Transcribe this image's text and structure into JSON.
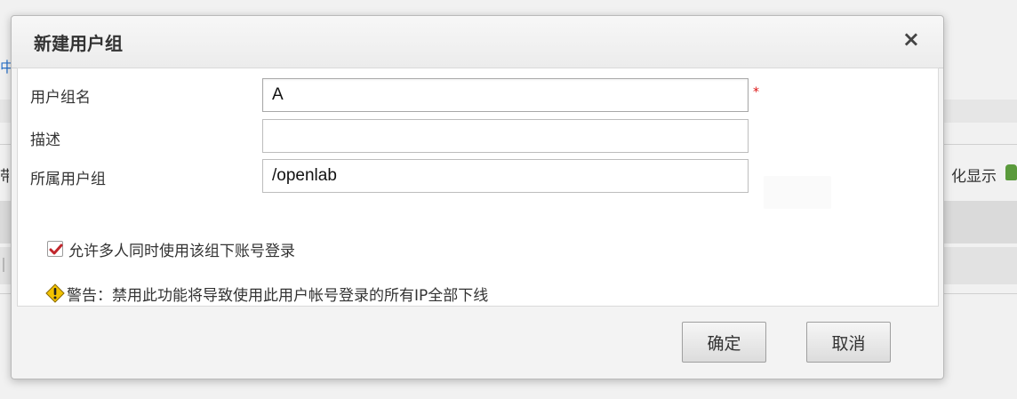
{
  "background": {
    "left_link_fragment": "中",
    "left_text_fragment": "带",
    "right_text": "化显示"
  },
  "dialog": {
    "title": "新建用户组",
    "close_symbol": "×",
    "fields": {
      "group_name": {
        "label": "用户组名",
        "value": "A",
        "required_mark": "*"
      },
      "description": {
        "label": "描述",
        "value": ""
      },
      "parent_group": {
        "label": "所属用户组",
        "value": "/openlab"
      }
    },
    "checkbox": {
      "label": "允许多人同时使用该组下账号登录",
      "checked": true
    },
    "warning": {
      "text": "警告：禁用此功能将导致使用此用户帐号登录的所有IP全部下线"
    },
    "buttons": {
      "ok": "确定",
      "cancel": "取消"
    }
  },
  "colors": {
    "check_mark": "#c0262c",
    "warning_yellow": "#f2c200",
    "required_star": "#dd1111"
  }
}
